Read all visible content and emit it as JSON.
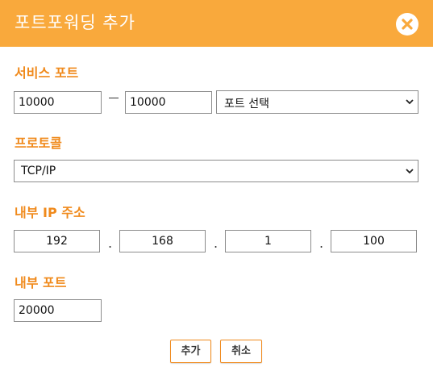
{
  "dialog": {
    "title": "포트포워딩 추가",
    "close_icon": "close-circle-x-icon"
  },
  "service_port": {
    "label": "서비스 포트",
    "start_value": "10000",
    "end_value": "10000",
    "port_select": "포트 선택"
  },
  "protocol": {
    "label": "프로토콜",
    "selected": "TCP/IP"
  },
  "internal_ip": {
    "label": "내부 IP 주소",
    "octets": [
      "192",
      "168",
      "1",
      "100"
    ],
    "separator": "."
  },
  "internal_port": {
    "label": "내부 포트",
    "value": "20000"
  },
  "actions": {
    "add_label": "추가",
    "cancel_label": "취소"
  },
  "colors": {
    "header": "#f9a93c",
    "label": "#f08a1c",
    "button_border": "#f08a1c"
  }
}
